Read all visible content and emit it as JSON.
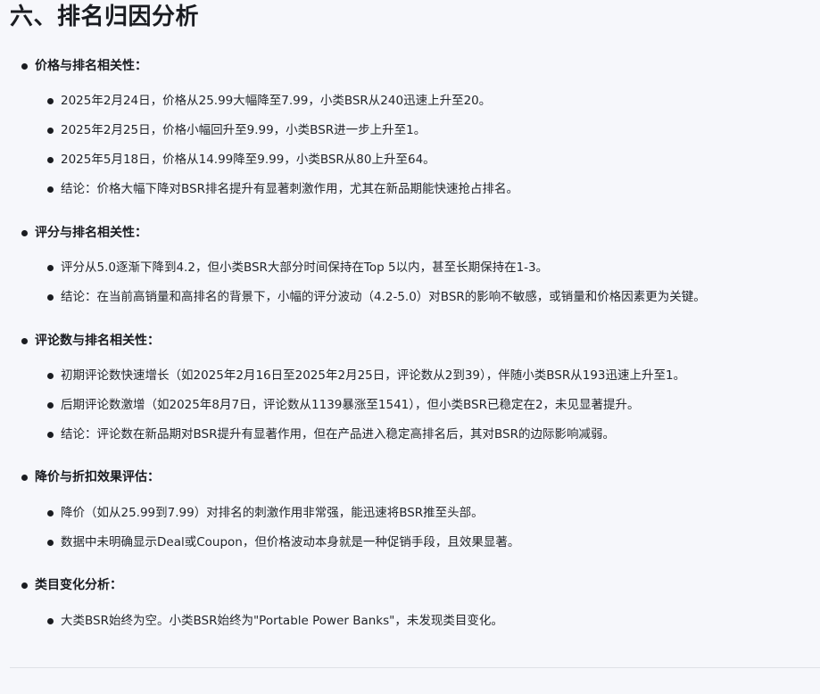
{
  "title": "六、排名归因分析",
  "sections": [
    {
      "heading": "价格与排名相关性：",
      "items": [
        "2025年2月24日，价格从25.99大幅降至7.99，小类BSR从240迅速上升至20。",
        "2025年2月25日，价格小幅回升至9.99，小类BSR进一步上升至1。",
        "2025年5月18日，价格从14.99降至9.99，小类BSR从80上升至64。",
        "结论：价格大幅下降对BSR排名提升有显著刺激作用，尤其在新品期能快速抢占排名。"
      ]
    },
    {
      "heading": "评分与排名相关性：",
      "items": [
        "评分从5.0逐渐下降到4.2，但小类BSR大部分时间保持在Top 5以内，甚至长期保持在1-3。",
        "结论：在当前高销量和高排名的背景下，小幅的评分波动（4.2-5.0）对BSR的影响不敏感，或销量和价格因素更为关键。"
      ]
    },
    {
      "heading": "评论数与排名相关性：",
      "items": [
        "初期评论数快速增长（如2025年2月16日至2025年2月25日，评论数从2到39），伴随小类BSR从193迅速上升至1。",
        "后期评论数激增（如2025年8月7日，评论数从1139暴涨至1541），但小类BSR已稳定在2，未见显著提升。",
        "结论：评论数在新品期对BSR提升有显著作用，但在产品进入稳定高排名后，其对BSR的边际影响减弱。"
      ]
    },
    {
      "heading": "降价与折扣效果评估：",
      "items": [
        "降价（如从25.99到7.99）对排名的刺激作用非常强，能迅速将BSR推至头部。",
        "数据中未明确显示Deal或Coupon，但价格波动本身就是一种促销手段，且效果显著。"
      ]
    },
    {
      "heading": "类目变化分析：",
      "items": [
        "大类BSR始终为空。小类BSR始终为\"Portable Power Banks\"，未发现类目变化。"
      ]
    }
  ]
}
